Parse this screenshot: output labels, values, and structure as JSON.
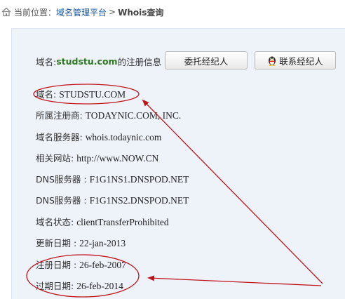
{
  "breadcrumb": {
    "prefix": "当前位置：",
    "link": "域名管理平台",
    "separator": ">",
    "current": "Whois查询"
  },
  "header": {
    "prefix": "域名:",
    "domain": "studstu.com",
    "suffix": "的注册信息"
  },
  "buttons": {
    "entrust": "委托经纪人",
    "contact": "联系经纪人"
  },
  "whois": [
    {
      "label": "域名: ",
      "value": "STUDSTU.COM"
    },
    {
      "label": "所属注册商: ",
      "value": "TODAYNIC.COM, INC."
    },
    {
      "label": "域名服务器: ",
      "value": "whois.todaynic.com"
    },
    {
      "label": "相关网站: ",
      "value": "http://www.NOW.CN"
    },
    {
      "label": "DNS服务器 : ",
      "value": "F1G1NS1.DNSPOD.NET"
    },
    {
      "label": "DNS服务器 : ",
      "value": "F1G1NS2.DNSPOD.NET"
    },
    {
      "label": "域名状态: ",
      "value": "clientTransferProhibited"
    },
    {
      "label": "更新日期 : ",
      "value": "22-jan-2013"
    },
    {
      "label": "注册日期 : ",
      "value": "26-feb-2007"
    },
    {
      "label": "过期日期: ",
      "value": "26-feb-2014"
    }
  ],
  "colors": {
    "accent_domain": "#2c7a1f",
    "link": "#1a55a0",
    "panel_bg": "#eef3fa",
    "annotation": "#c0141c"
  },
  "icons": {
    "home": "home-icon",
    "qq": "qq-penguin-icon"
  }
}
